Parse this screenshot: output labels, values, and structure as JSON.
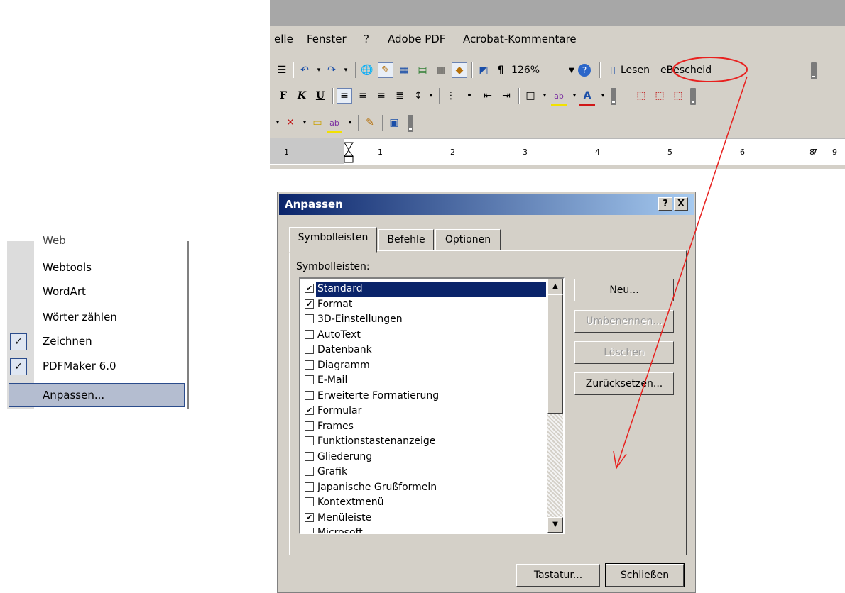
{
  "menubar": {
    "items": [
      "elle",
      "Fenster",
      "?",
      "Adobe PDF",
      "Acrobat-Kommentare"
    ]
  },
  "toolbar": {
    "zoom": "126%",
    "read_label": "Lesen",
    "ebescheid_label": "eBescheid",
    "bold": "F",
    "italic": "K",
    "underline": "U",
    "pilcrow": "¶"
  },
  "ruler": {
    "ticks": [
      "1",
      "1",
      "2",
      "3",
      "4",
      "5",
      "6",
      "7",
      "8",
      "9"
    ]
  },
  "context_menu": {
    "partial_item": "Web",
    "items": [
      "Webtools",
      "WordArt",
      "Wörter zählen",
      "Zeichnen",
      "PDFMaker 6.0",
      "Anpassen..."
    ],
    "checked": [
      "Zeichnen",
      "PDFMaker 6.0"
    ],
    "highlighted": "Anpassen..."
  },
  "dialog": {
    "title": "Anpassen",
    "help_btn": "?",
    "close_btn": "X",
    "tabs": [
      "Symbolleisten",
      "Befehle",
      "Optionen"
    ],
    "active_tab": "Symbolleisten",
    "list_label": "Symbolleisten:",
    "toolbars": [
      {
        "label": "Standard",
        "checked": true,
        "selected": true
      },
      {
        "label": "Format",
        "checked": true
      },
      {
        "label": "3D-Einstellungen",
        "checked": false
      },
      {
        "label": "AutoText",
        "checked": false
      },
      {
        "label": "Datenbank",
        "checked": false
      },
      {
        "label": "Diagramm",
        "checked": false
      },
      {
        "label": "E-Mail",
        "checked": false
      },
      {
        "label": "Erweiterte Formatierung",
        "checked": false
      },
      {
        "label": "Formular",
        "checked": true
      },
      {
        "label": "Frames",
        "checked": false
      },
      {
        "label": "Funktionstastenanzeige",
        "checked": false
      },
      {
        "label": "Gliederung",
        "checked": false
      },
      {
        "label": "Grafik",
        "checked": false
      },
      {
        "label": "Japanische Grußformeln",
        "checked": false
      },
      {
        "label": "Kontextmenü",
        "checked": false
      },
      {
        "label": "Menüleiste",
        "checked": true
      },
      {
        "label": "Microsoft",
        "checked": false
      }
    ],
    "buttons": {
      "new": "Neu...",
      "rename": "Umbenennen...",
      "delete": "Löschen",
      "reset": "Zurücksetzen...",
      "keyboard": "Tastatur...",
      "close": "Schließen"
    }
  },
  "colors": {
    "dialog_face": "#d4d0c8",
    "title_start": "#0a246a",
    "title_end": "#a6caf0",
    "annotation": "#e8201e"
  }
}
